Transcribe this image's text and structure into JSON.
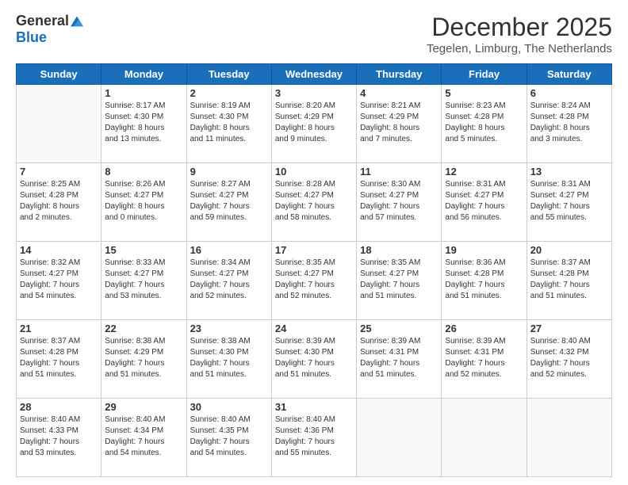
{
  "logo": {
    "general": "General",
    "blue": "Blue"
  },
  "header": {
    "month": "December 2025",
    "location": "Tegelen, Limburg, The Netherlands"
  },
  "days_of_week": [
    "Sunday",
    "Monday",
    "Tuesday",
    "Wednesday",
    "Thursday",
    "Friday",
    "Saturday"
  ],
  "weeks": [
    [
      {
        "day": "",
        "info": ""
      },
      {
        "day": "1",
        "info": "Sunrise: 8:17 AM\nSunset: 4:30 PM\nDaylight: 8 hours\nand 13 minutes."
      },
      {
        "day": "2",
        "info": "Sunrise: 8:19 AM\nSunset: 4:30 PM\nDaylight: 8 hours\nand 11 minutes."
      },
      {
        "day": "3",
        "info": "Sunrise: 8:20 AM\nSunset: 4:29 PM\nDaylight: 8 hours\nand 9 minutes."
      },
      {
        "day": "4",
        "info": "Sunrise: 8:21 AM\nSunset: 4:29 PM\nDaylight: 8 hours\nand 7 minutes."
      },
      {
        "day": "5",
        "info": "Sunrise: 8:23 AM\nSunset: 4:28 PM\nDaylight: 8 hours\nand 5 minutes."
      },
      {
        "day": "6",
        "info": "Sunrise: 8:24 AM\nSunset: 4:28 PM\nDaylight: 8 hours\nand 3 minutes."
      }
    ],
    [
      {
        "day": "7",
        "info": "Sunrise: 8:25 AM\nSunset: 4:28 PM\nDaylight: 8 hours\nand 2 minutes."
      },
      {
        "day": "8",
        "info": "Sunrise: 8:26 AM\nSunset: 4:27 PM\nDaylight: 8 hours\nand 0 minutes."
      },
      {
        "day": "9",
        "info": "Sunrise: 8:27 AM\nSunset: 4:27 PM\nDaylight: 7 hours\nand 59 minutes."
      },
      {
        "day": "10",
        "info": "Sunrise: 8:28 AM\nSunset: 4:27 PM\nDaylight: 7 hours\nand 58 minutes."
      },
      {
        "day": "11",
        "info": "Sunrise: 8:30 AM\nSunset: 4:27 PM\nDaylight: 7 hours\nand 57 minutes."
      },
      {
        "day": "12",
        "info": "Sunrise: 8:31 AM\nSunset: 4:27 PM\nDaylight: 7 hours\nand 56 minutes."
      },
      {
        "day": "13",
        "info": "Sunrise: 8:31 AM\nSunset: 4:27 PM\nDaylight: 7 hours\nand 55 minutes."
      }
    ],
    [
      {
        "day": "14",
        "info": "Sunrise: 8:32 AM\nSunset: 4:27 PM\nDaylight: 7 hours\nand 54 minutes."
      },
      {
        "day": "15",
        "info": "Sunrise: 8:33 AM\nSunset: 4:27 PM\nDaylight: 7 hours\nand 53 minutes."
      },
      {
        "day": "16",
        "info": "Sunrise: 8:34 AM\nSunset: 4:27 PM\nDaylight: 7 hours\nand 52 minutes."
      },
      {
        "day": "17",
        "info": "Sunrise: 8:35 AM\nSunset: 4:27 PM\nDaylight: 7 hours\nand 52 minutes."
      },
      {
        "day": "18",
        "info": "Sunrise: 8:35 AM\nSunset: 4:27 PM\nDaylight: 7 hours\nand 51 minutes."
      },
      {
        "day": "19",
        "info": "Sunrise: 8:36 AM\nSunset: 4:28 PM\nDaylight: 7 hours\nand 51 minutes."
      },
      {
        "day": "20",
        "info": "Sunrise: 8:37 AM\nSunset: 4:28 PM\nDaylight: 7 hours\nand 51 minutes."
      }
    ],
    [
      {
        "day": "21",
        "info": "Sunrise: 8:37 AM\nSunset: 4:28 PM\nDaylight: 7 hours\nand 51 minutes."
      },
      {
        "day": "22",
        "info": "Sunrise: 8:38 AM\nSunset: 4:29 PM\nDaylight: 7 hours\nand 51 minutes."
      },
      {
        "day": "23",
        "info": "Sunrise: 8:38 AM\nSunset: 4:30 PM\nDaylight: 7 hours\nand 51 minutes."
      },
      {
        "day": "24",
        "info": "Sunrise: 8:39 AM\nSunset: 4:30 PM\nDaylight: 7 hours\nand 51 minutes."
      },
      {
        "day": "25",
        "info": "Sunrise: 8:39 AM\nSunset: 4:31 PM\nDaylight: 7 hours\nand 51 minutes."
      },
      {
        "day": "26",
        "info": "Sunrise: 8:39 AM\nSunset: 4:31 PM\nDaylight: 7 hours\nand 52 minutes."
      },
      {
        "day": "27",
        "info": "Sunrise: 8:40 AM\nSunset: 4:32 PM\nDaylight: 7 hours\nand 52 minutes."
      }
    ],
    [
      {
        "day": "28",
        "info": "Sunrise: 8:40 AM\nSunset: 4:33 PM\nDaylight: 7 hours\nand 53 minutes."
      },
      {
        "day": "29",
        "info": "Sunrise: 8:40 AM\nSunset: 4:34 PM\nDaylight: 7 hours\nand 54 minutes."
      },
      {
        "day": "30",
        "info": "Sunrise: 8:40 AM\nSunset: 4:35 PM\nDaylight: 7 hours\nand 54 minutes."
      },
      {
        "day": "31",
        "info": "Sunrise: 8:40 AM\nSunset: 4:36 PM\nDaylight: 7 hours\nand 55 minutes."
      },
      {
        "day": "",
        "info": ""
      },
      {
        "day": "",
        "info": ""
      },
      {
        "day": "",
        "info": ""
      }
    ]
  ]
}
